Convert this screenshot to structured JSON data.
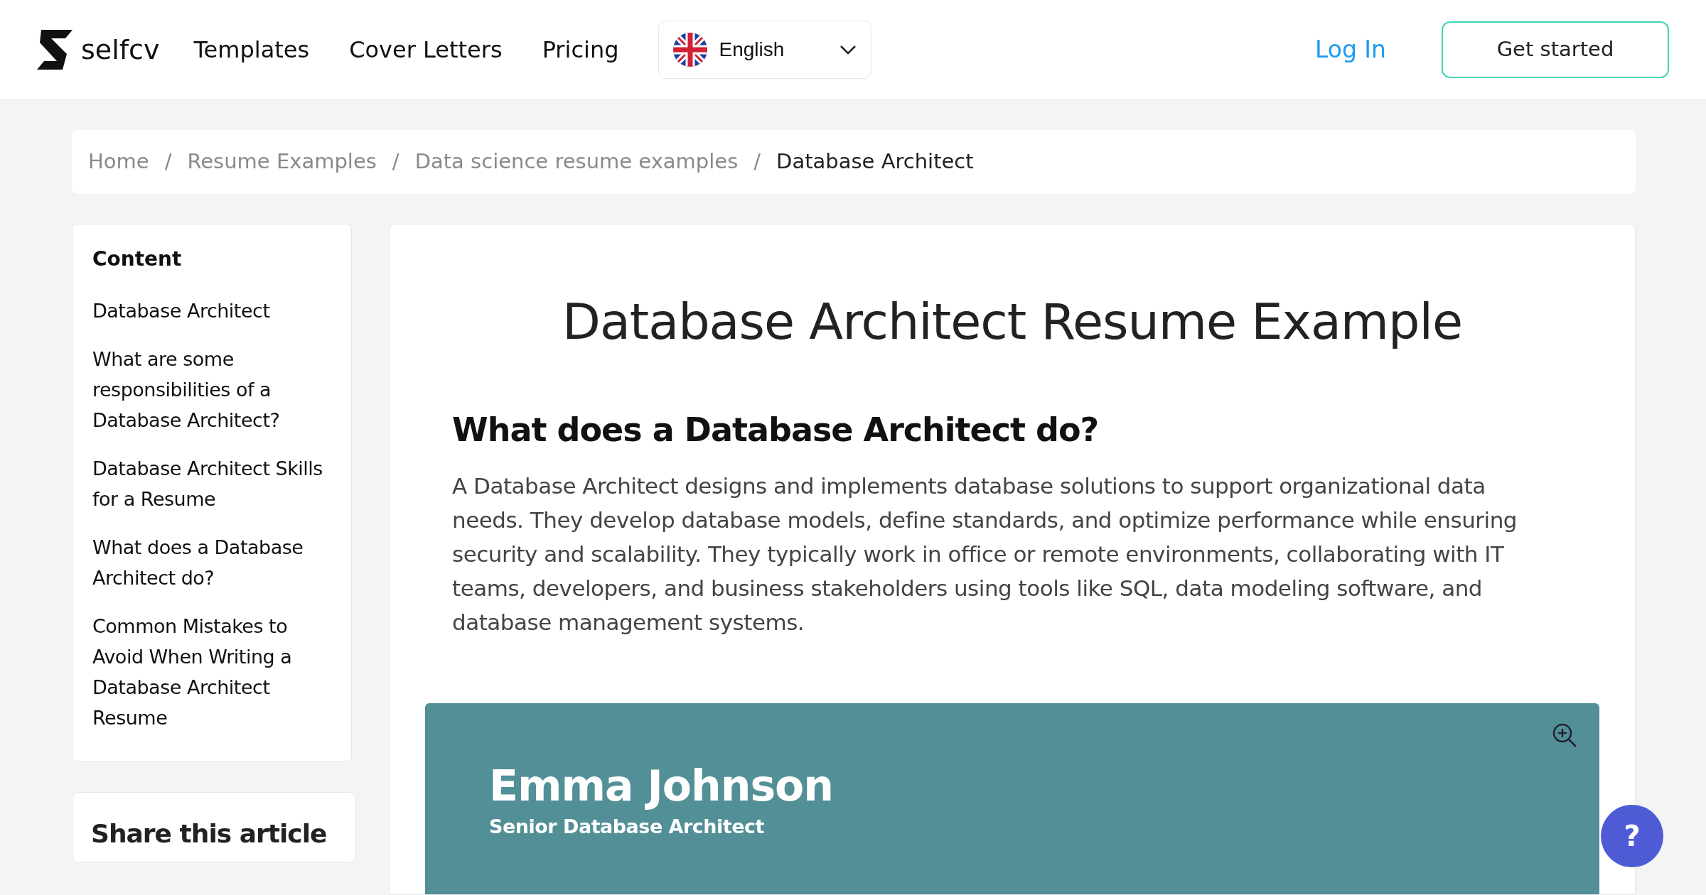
{
  "header": {
    "logo_text": "selfcv",
    "nav": [
      "Templates",
      "Cover Letters",
      "Pricing"
    ],
    "language": {
      "label": "English"
    },
    "login": "Log In",
    "cta": "Get started"
  },
  "breadcrumb": [
    {
      "label": "Home",
      "current": false
    },
    {
      "label": "Resume Examples",
      "current": false
    },
    {
      "label": "Data science resume examples",
      "current": false
    },
    {
      "label": "Database Architect",
      "current": true
    }
  ],
  "breadcrumb_separator": "/",
  "sidebar": {
    "title": "Content",
    "items": [
      "Database Architect",
      "What are some responsibilities of a Database Architect?",
      "Database Architect Skills for a Resume",
      "What does a Database Architect do?",
      "Common Mistakes to Avoid When Writing a Database Architect Resume"
    ]
  },
  "share": {
    "title": "Share this article"
  },
  "article": {
    "title": "Database Architect Resume Example",
    "heading": "What does a Database Architect do?",
    "paragraph": "A Database Architect designs and implements database solutions to support organizational data needs. They develop database models, define standards, and optimize performance while ensuring security and scalability. They typically work in office or remote environments, collaborating with IT teams, developers, and business stakeholders using tools like SQL, data modeling software, and database management systems."
  },
  "resume_preview": {
    "name": "Emma Johnson",
    "role": "Senior Database Architect"
  },
  "help_button": "?"
}
